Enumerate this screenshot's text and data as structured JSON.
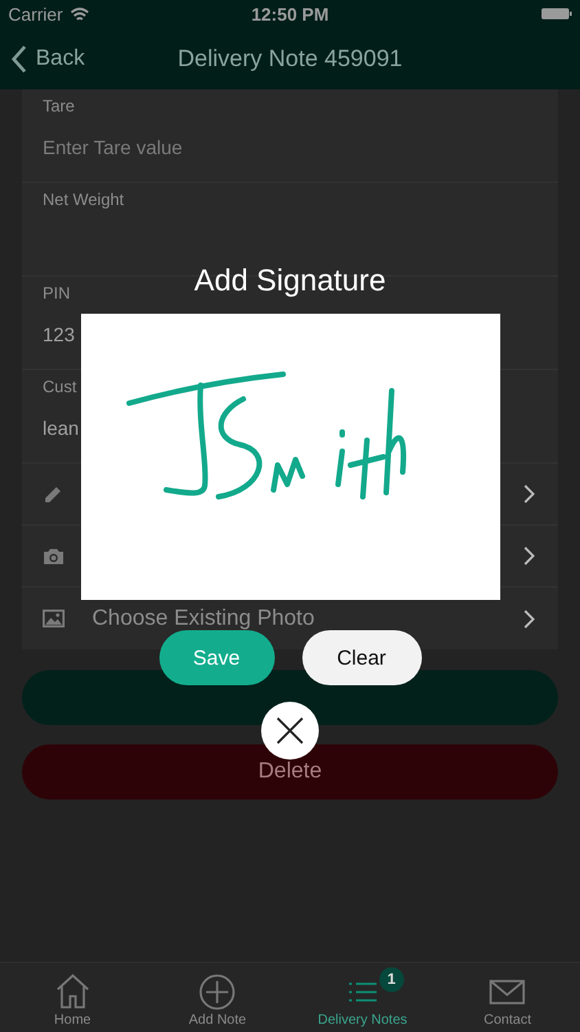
{
  "status_bar": {
    "carrier": "Carrier",
    "time": "12:50 PM"
  },
  "nav": {
    "back": "Back",
    "title": "Delivery Note 459091"
  },
  "form": [
    {
      "kind": "field",
      "label": "Tare",
      "placeholder": "Enter Tare value"
    },
    {
      "kind": "field",
      "label": "Net Weight"
    },
    {
      "kind": "field",
      "label": "PIN",
      "value": "123"
    },
    {
      "kind": "field",
      "label": "Cust",
      "value": "lean"
    },
    {
      "kind": "sign"
    },
    {
      "kind": "camera"
    },
    {
      "kind": "gallery",
      "label": "Choose Existing Photo"
    }
  ],
  "actions": [
    {
      "kind": "primary"
    },
    {
      "kind": "delete",
      "label": "Delete"
    }
  ],
  "tab_bar": [
    {
      "kind": "home",
      "label": "Home",
      "selected": false
    },
    {
      "kind": "add",
      "label": "Add Note",
      "selected": false
    },
    {
      "kind": "list",
      "label": "Delivery Notes",
      "selected": true,
      "badge": "1"
    },
    {
      "kind": "mail",
      "label": "Contact",
      "selected": false
    }
  ],
  "modal": {
    "title": "Add Signature",
    "buttons": [
      {
        "kind": "save",
        "label": "Save"
      },
      {
        "kind": "clear",
        "label": "Clear"
      }
    ]
  }
}
